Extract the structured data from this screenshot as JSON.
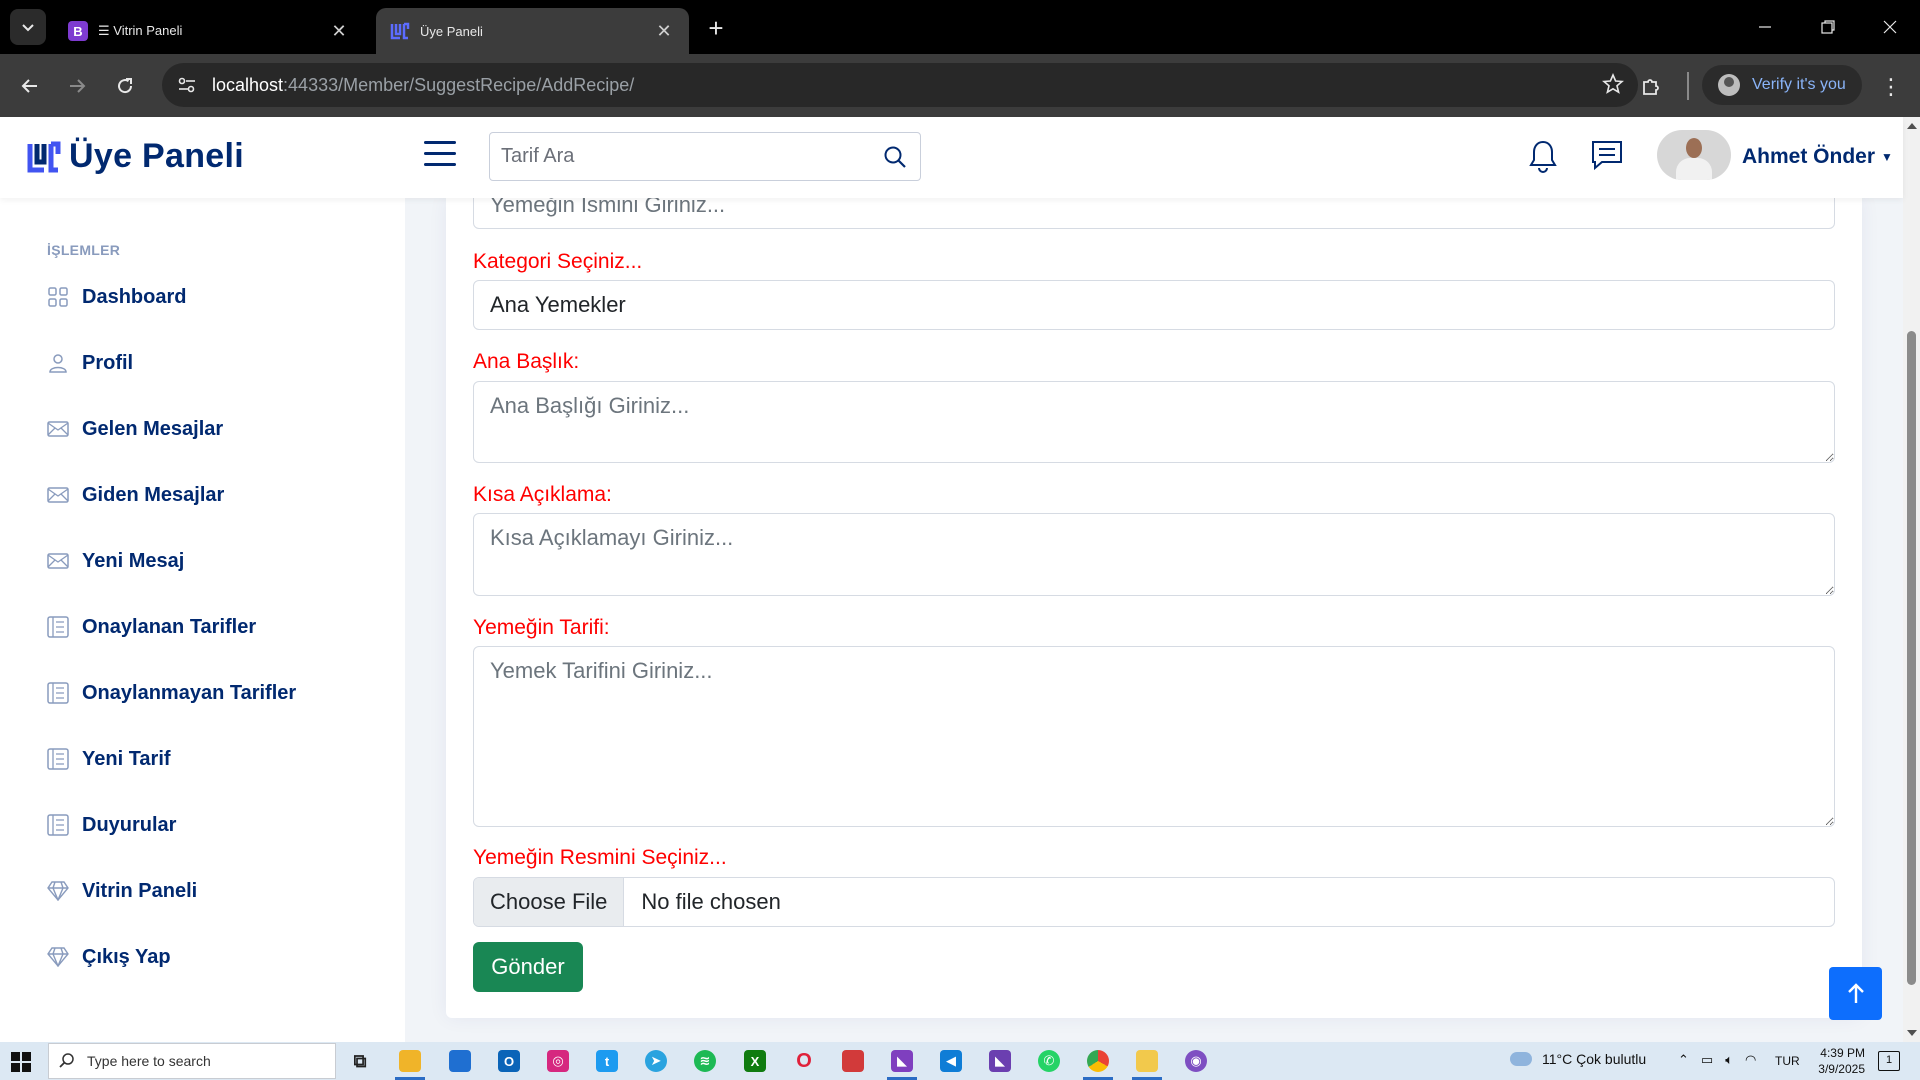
{
  "browser": {
    "tabs": [
      {
        "favicon": "B",
        "title": "☰ Vitrin Paneli",
        "active": false
      },
      {
        "favicon": "logo",
        "title": "Üye Paneli",
        "active": true
      }
    ],
    "url_host": "localhost",
    "url_path": ":44333/Member/SuggestRecipe/AddRecipe/",
    "profile_label": "Verify it's you"
  },
  "header": {
    "logo_text": "Üye Paneli",
    "search_placeholder": "Tarif Ara",
    "user_name": "Ahmet Önder"
  },
  "sidebar": {
    "heading": "İŞLEMLER",
    "items": [
      {
        "label": "Dashboard",
        "icon": "grid-icon"
      },
      {
        "label": "Profil",
        "icon": "person-icon"
      },
      {
        "label": "Gelen Mesajlar",
        "icon": "envelope-icon"
      },
      {
        "label": "Giden Mesajlar",
        "icon": "envelope-icon"
      },
      {
        "label": "Yeni Mesaj",
        "icon": "envelope-icon"
      },
      {
        "label": "Onaylanan Tarifler",
        "icon": "layout-text-icon"
      },
      {
        "label": "Onaylanmayan Tarifler",
        "icon": "layout-text-icon"
      },
      {
        "label": "Yeni Tarif",
        "icon": "layout-text-icon"
      },
      {
        "label": "Duyurular",
        "icon": "layout-text-icon"
      },
      {
        "label": "Vitrin Paneli",
        "icon": "gem-icon"
      },
      {
        "label": "Çıkış Yap",
        "icon": "gem-icon"
      }
    ]
  },
  "form": {
    "name_placeholder": "Yemeğin Ismini Giriniz...",
    "category_label": "Kategori Seçiniz...",
    "category_value": "Ana Yemekler",
    "title_label": "Ana Başlık:",
    "title_placeholder": "Ana Başlığı Giriniz...",
    "summary_label": "Kısa Açıklama:",
    "summary_placeholder": "Kısa Açıklamayı Giriniz...",
    "recipe_label": "Yemeğin Tarifi:",
    "recipe_placeholder": "Yemek Tarifini Giriniz...",
    "image_label": "Yemeğin Resmini Seçiniz...",
    "file_button": "Choose File",
    "file_status": "No file chosen",
    "submit_label": "Gönder"
  },
  "taskbar": {
    "search_placeholder": "Type here to search",
    "weather": "11°C  Çok bulutlu",
    "language": "TUR",
    "time": "4:39 PM",
    "date": "3/9/2025",
    "notification_count": "1"
  },
  "colors": {
    "brand": "#012970",
    "label_red": "#ff0000",
    "submit_green": "#198754",
    "back_top_blue": "#0d6efd"
  }
}
